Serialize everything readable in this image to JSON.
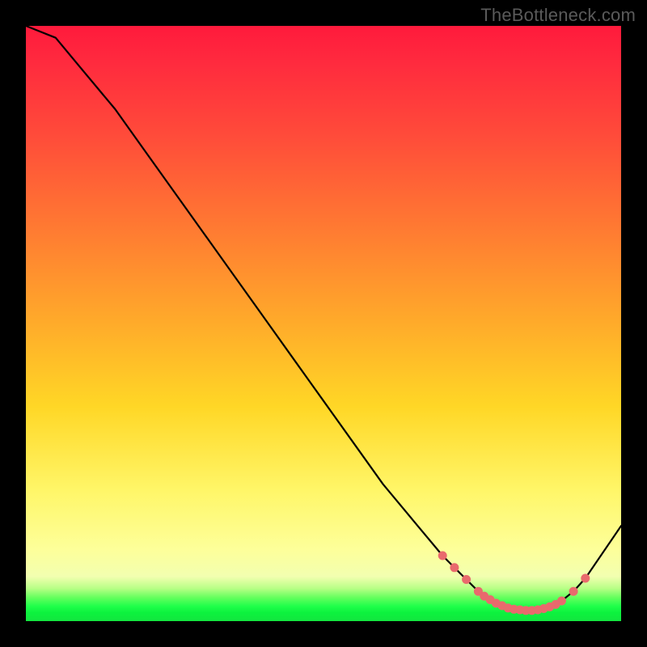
{
  "watermark": "TheBottleneck.com",
  "chart_data": {
    "type": "line",
    "title": "",
    "xlabel": "",
    "ylabel": "",
    "xlim": [
      0,
      100
    ],
    "ylim": [
      0,
      100
    ],
    "grid": false,
    "legend": false,
    "x": [
      0,
      5,
      10,
      15,
      20,
      25,
      30,
      35,
      40,
      45,
      50,
      55,
      60,
      65,
      70,
      72,
      74,
      76,
      78,
      80,
      82,
      84,
      86,
      88,
      90,
      92,
      94,
      100
    ],
    "values": [
      100,
      98,
      92,
      86,
      79,
      72,
      65,
      58,
      51,
      44,
      37,
      30,
      23,
      17,
      11,
      9,
      7,
      5,
      3.6,
      2.6,
      2.0,
      1.8,
      1.9,
      2.4,
      3.4,
      5.0,
      7.2,
      16
    ],
    "markers_x": [
      70,
      72,
      74,
      76,
      77,
      78,
      79,
      80,
      81,
      82,
      83,
      84,
      85,
      86,
      87,
      88,
      89,
      90,
      92,
      94
    ],
    "markers_y": [
      11,
      9,
      7,
      5,
      4.2,
      3.6,
      3.0,
      2.6,
      2.2,
      2.0,
      1.9,
      1.8,
      1.8,
      1.9,
      2.1,
      2.4,
      2.8,
      3.4,
      5.0,
      7.2
    ],
    "marker_color": "#e96a6d"
  },
  "colors": {
    "background": "#000000",
    "gradient_top": "#ff1a3c",
    "gradient_mid": "#ffd726",
    "gradient_bottom": "#13e63f",
    "line": "#000000"
  }
}
